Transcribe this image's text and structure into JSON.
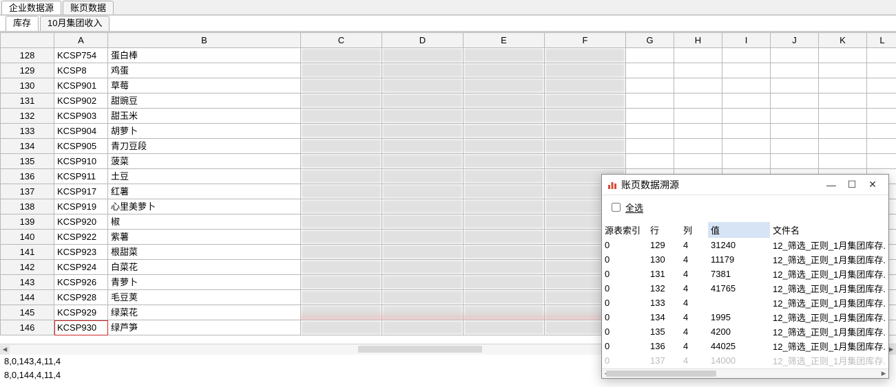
{
  "topTabs": {
    "active": "企业数据源",
    "inactive": "账页数据"
  },
  "sheetTabs": {
    "active": "库存",
    "inactive": "10月集团收入"
  },
  "columns": [
    "A",
    "B",
    "C",
    "D",
    "E",
    "F",
    "G",
    "H",
    "I",
    "J",
    "K",
    "L"
  ],
  "rows": [
    {
      "n": "128",
      "a": "KCSP754",
      "b": "蛋白棒"
    },
    {
      "n": "129",
      "a": "KCSP8",
      "b": "鸡蛋"
    },
    {
      "n": "130",
      "a": "KCSP901",
      "b": "草莓"
    },
    {
      "n": "131",
      "a": "KCSP902",
      "b": "甜豌豆"
    },
    {
      "n": "132",
      "a": "KCSP903",
      "b": "甜玉米"
    },
    {
      "n": "133",
      "a": "KCSP904",
      "b": "胡萝卜"
    },
    {
      "n": "134",
      "a": "KCSP905",
      "b": "青刀豆段"
    },
    {
      "n": "135",
      "a": "KCSP910",
      "b": "菠菜"
    },
    {
      "n": "136",
      "a": "KCSP911",
      "b": "土豆"
    },
    {
      "n": "137",
      "a": "KCSP917",
      "b": "红薯"
    },
    {
      "n": "138",
      "a": "KCSP919",
      "b": "心里美萝卜"
    },
    {
      "n": "139",
      "a": "KCSP920",
      "b": "椒"
    },
    {
      "n": "140",
      "a": "KCSP922",
      "b": "紫薯"
    },
    {
      "n": "141",
      "a": "KCSP923",
      "b": "根甜菜"
    },
    {
      "n": "142",
      "a": "KCSP924",
      "b": "白菜花"
    },
    {
      "n": "143",
      "a": "KCSP926",
      "b": "青萝卜"
    },
    {
      "n": "144",
      "a": "KCSP928",
      "b": "毛豆荚"
    },
    {
      "n": "145",
      "a": "KCSP929",
      "b": "绿菜花"
    },
    {
      "n": "146",
      "a": "KCSP930",
      "b": "绿芦笋"
    }
  ],
  "status": {
    "line1": "8,0,143,4,11,4",
    "line2": "8,0,144,4,11,4"
  },
  "dialog": {
    "title": "账页数据溯源",
    "selectAll": "全选",
    "headers": {
      "srcIndex": "源表索引",
      "row": "行",
      "col": "列",
      "value": "值",
      "file": "文件名"
    },
    "fileLabel": "12_筛选_正则_1月集团库存.",
    "rows": [
      {
        "idx": "0",
        "row": "129",
        "col": "4",
        "val": "31240"
      },
      {
        "idx": "0",
        "row": "130",
        "col": "4",
        "val": "11179"
      },
      {
        "idx": "0",
        "row": "131",
        "col": "4",
        "val": "7381"
      },
      {
        "idx": "0",
        "row": "132",
        "col": "4",
        "val": "41765"
      },
      {
        "idx": "0",
        "row": "133",
        "col": "4",
        "val": ""
      },
      {
        "idx": "0",
        "row": "134",
        "col": "4",
        "val": "1995"
      },
      {
        "idx": "0",
        "row": "135",
        "col": "4",
        "val": "4200"
      },
      {
        "idx": "0",
        "row": "136",
        "col": "4",
        "val": "44025"
      },
      {
        "idx": "0",
        "row": "137",
        "col": "4",
        "val": "14000"
      }
    ]
  }
}
